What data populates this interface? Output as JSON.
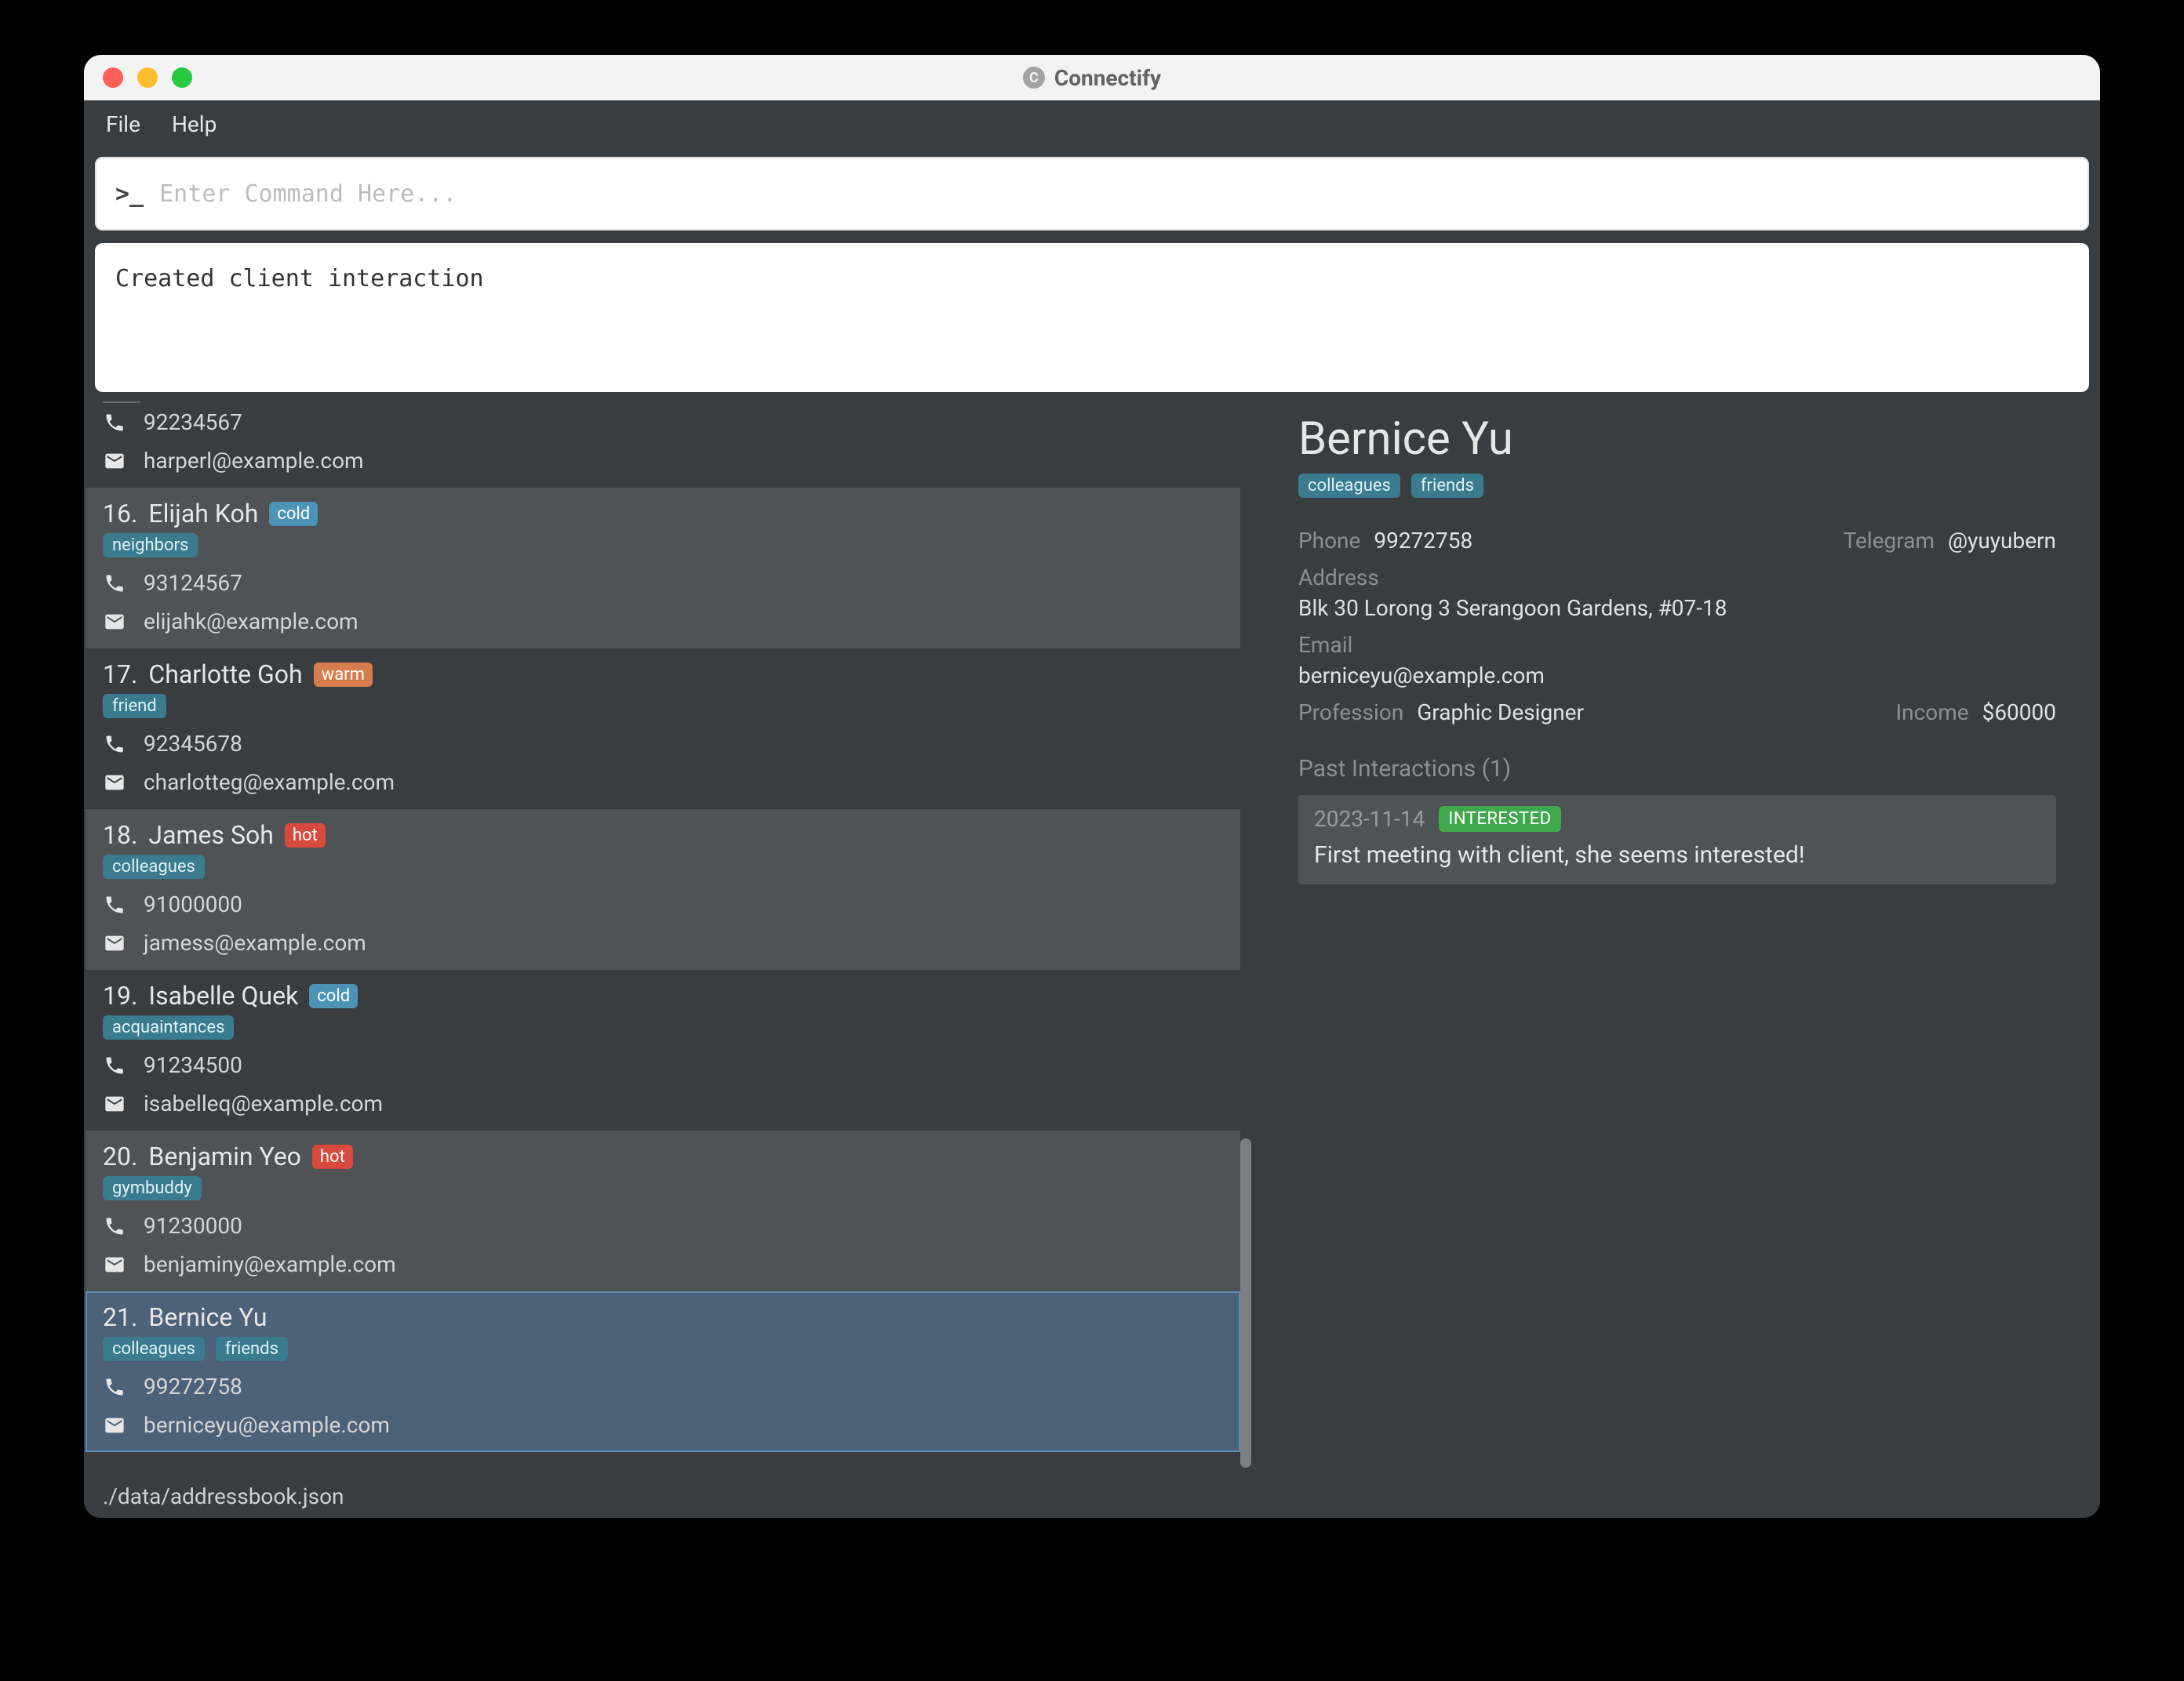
{
  "window": {
    "title": "Connectify"
  },
  "menu": {
    "file": "File",
    "help": "Help"
  },
  "command": {
    "placeholder": "Enter Command Here..."
  },
  "output": {
    "text": "Created client interaction"
  },
  "statusbar": {
    "path": "./data/addressbook.json"
  },
  "people": [
    {
      "index": "",
      "name": "",
      "lead": "",
      "tags": [],
      "phone": "92234567",
      "email": "harperl@example.com",
      "partial": true
    },
    {
      "index": "16.",
      "name": "Elijah Koh",
      "lead": "cold",
      "tags": [
        "neighbors"
      ],
      "phone": "93124567",
      "email": "elijahk@example.com",
      "alt": true
    },
    {
      "index": "17.",
      "name": "Charlotte Goh",
      "lead": "warm",
      "tags": [
        "friend"
      ],
      "phone": "92345678",
      "email": "charlotteg@example.com"
    },
    {
      "index": "18.",
      "name": "James Soh",
      "lead": "hot",
      "tags": [
        "colleagues"
      ],
      "phone": "91000000",
      "email": "jamess@example.com",
      "alt": true
    },
    {
      "index": "19.",
      "name": "Isabelle Quek",
      "lead": "cold",
      "tags": [
        "acquaintances"
      ],
      "phone": "91234500",
      "email": "isabelleq@example.com"
    },
    {
      "index": "20.",
      "name": "Benjamin Yeo",
      "lead": "hot",
      "tags": [
        "gymbuddy"
      ],
      "phone": "91230000",
      "email": "benjaminy@example.com",
      "alt": true
    },
    {
      "index": "21.",
      "name": "Bernice Yu",
      "lead": "",
      "tags": [
        "colleagues",
        "friends"
      ],
      "phone": "99272758",
      "email": "berniceyu@example.com",
      "selected": true
    }
  ],
  "detail": {
    "name": "Bernice Yu",
    "tags": [
      "colleagues",
      "friends"
    ],
    "phoneLabel": "Phone",
    "phone": "99272758",
    "telegramLabel": "Telegram",
    "telegram": "@yuyubern",
    "addressLabel": "Address",
    "address": "Blk 30 Lorong 3 Serangoon Gardens, #07-18",
    "emailLabel": "Email",
    "email": "berniceyu@example.com",
    "professionLabel": "Profession",
    "profession": "Graphic Designer",
    "incomeLabel": "Income",
    "income": "$60000",
    "pastHeader": "Past Interactions (1)",
    "interactions": [
      {
        "date": "2023-11-14",
        "status": "INTERESTED",
        "note": "First meeting with client, she seems interested!"
      }
    ]
  }
}
